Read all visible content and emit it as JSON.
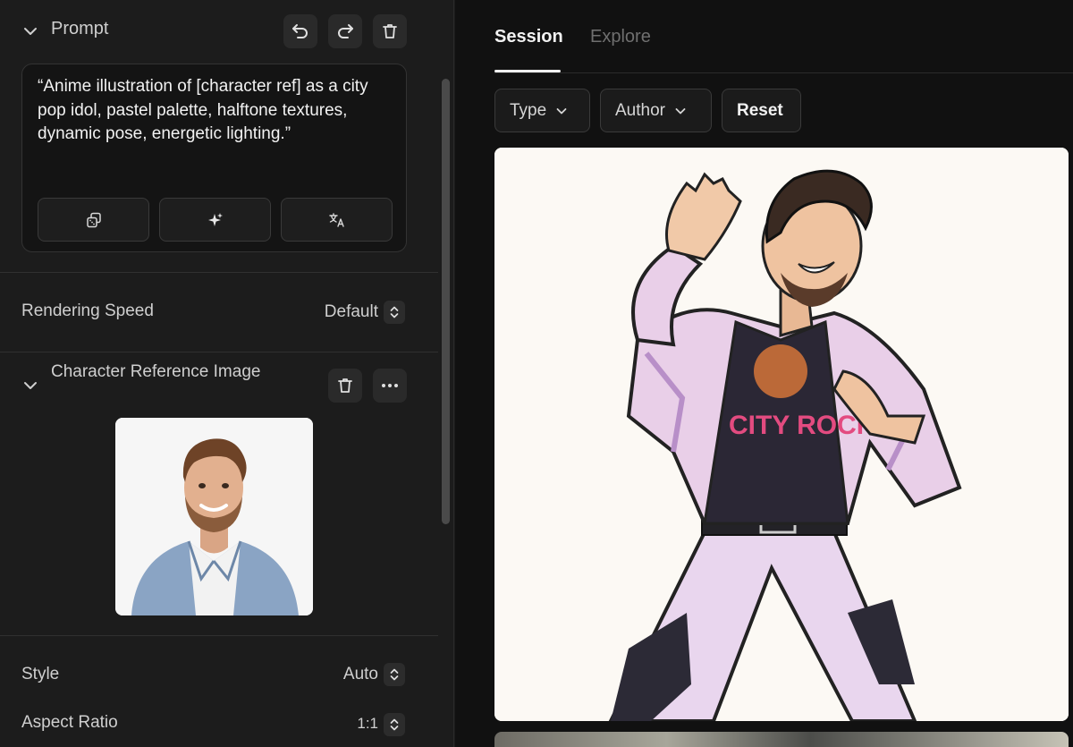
{
  "prompt": {
    "title": "Prompt",
    "text": "“Anime illustration of [character ref] as a city pop idol, pastel palette, halftone textures, dynamic pose, energetic lighting.”",
    "header_icons": [
      "undo-icon",
      "redo-icon",
      "trash-icon"
    ],
    "tool_icons": [
      "dice-icon",
      "sparkle-icon",
      "translate-icon"
    ]
  },
  "settings": {
    "rendering_speed": {
      "label": "Rendering Speed",
      "value": "Default"
    },
    "style": {
      "label": "Style",
      "value": "Auto"
    },
    "aspect_ratio": {
      "label": "Aspect Ratio",
      "value": "1:1"
    }
  },
  "character_reference": {
    "title": "Character Reference Image",
    "icons": [
      "trash-icon",
      "more-icon"
    ]
  },
  "tabs": [
    {
      "label": "Session",
      "active": true
    },
    {
      "label": "Explore",
      "active": false
    }
  ],
  "filters": {
    "type_label": "Type",
    "author_label": "Author",
    "reset_label": "Reset"
  },
  "gallery": {
    "main_image_shirt_text": "CITY ROCK"
  },
  "colors": {
    "panel_bg": "#1c1c1c",
    "content_bg": "#111111",
    "accent_text": "#f0f0f0",
    "muted_text": "#6f6f6f"
  }
}
